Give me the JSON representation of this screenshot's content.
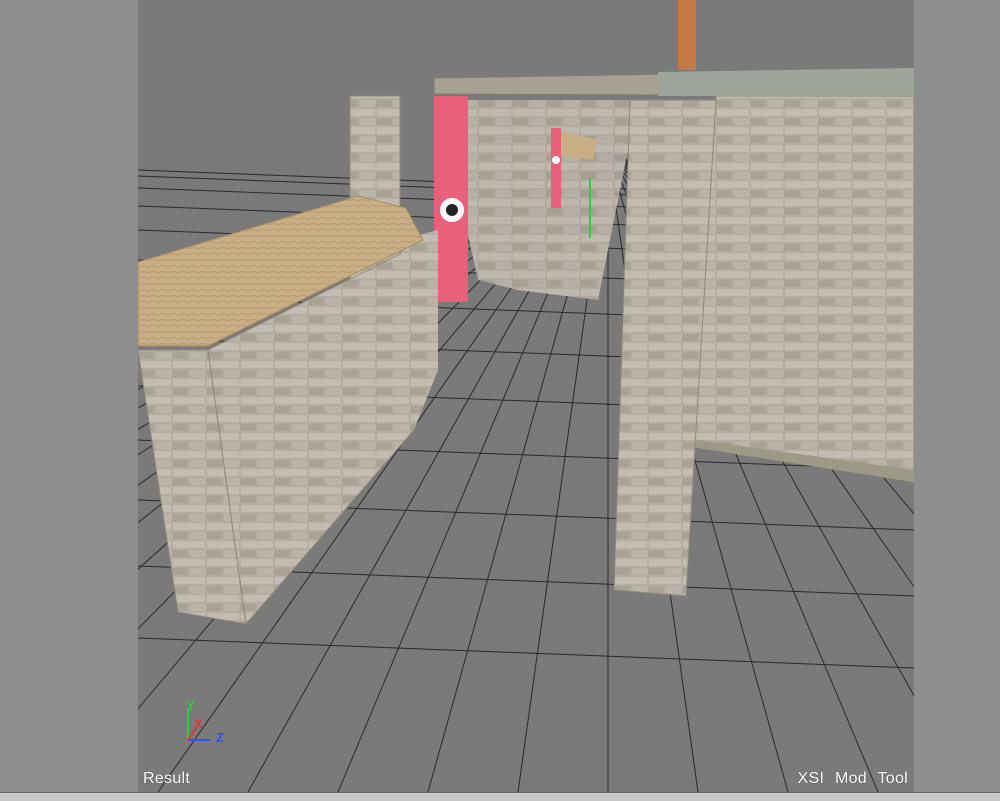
{
  "viewport": {
    "mode_label": "Result",
    "tool_label": "XSI Mod Tool",
    "axes": {
      "y": "Y",
      "x": "X",
      "z": "Z"
    }
  },
  "colors": {
    "background": "#7a7a7a",
    "side_panel": "#8e8e8e",
    "grid": "#2a2a2a",
    "banner": "#e8607a",
    "wall": "#b0a89c",
    "sandbag": "#c9ae85"
  },
  "scene": {
    "objects": [
      "brick-wall-left",
      "sandbag-top",
      "brick-pillar",
      "brick-wall-right",
      "lintel-beam",
      "red-banner",
      "ground-grid"
    ]
  }
}
